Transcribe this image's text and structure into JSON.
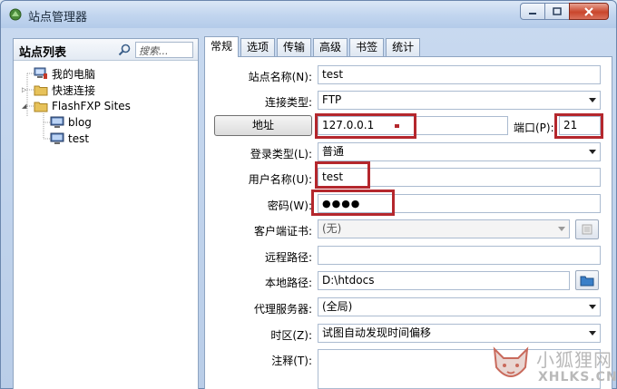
{
  "window": {
    "title": "站点管理器",
    "controls": [
      "minimize",
      "maximize",
      "close"
    ]
  },
  "left_panel": {
    "title": "站点列表",
    "search_placeholder": "搜索...",
    "tree": [
      {
        "label": "我的电脑",
        "icon": "computer-icon"
      },
      {
        "label": "快速连接",
        "icon": "folder-icon"
      },
      {
        "label": "FlashFXP Sites",
        "icon": "folder-icon"
      },
      {
        "label": "blog",
        "icon": "monitor-icon"
      },
      {
        "label": "test",
        "icon": "monitor-icon"
      }
    ]
  },
  "tabs": [
    "常规",
    "选项",
    "传输",
    "高级",
    "书签",
    "统计"
  ],
  "active_tab": "常规",
  "form": {
    "site_name_label": "站点名称(N):",
    "site_name_value": "test",
    "conn_type_label": "连接类型:",
    "conn_type_value": "FTP",
    "address_button": "地址",
    "address_value": "127.0.0.1",
    "port_label": "端口(P):",
    "port_value": "21",
    "login_type_label": "登录类型(L):",
    "login_type_value": "普通",
    "username_label": "用户名称(U):",
    "username_value": "test",
    "password_label": "密码(W):",
    "password_value": "●●●●",
    "cert_label": "客户端证书:",
    "cert_value": "(无)",
    "remote_path_label": "远程路径:",
    "remote_path_value": "",
    "local_path_label": "本地路径:",
    "local_path_value": "D:\\htdocs",
    "proxy_label": "代理服务器:",
    "proxy_value": "(全局)",
    "timezone_label": "时区(Z):",
    "timezone_value": "试图自动发现时间偏移",
    "notes_label": "注释(T):",
    "notes_value": ""
  },
  "colors": {
    "highlight_box": "#b4272d",
    "window_frame": "#b9cde8"
  },
  "watermark": {
    "text_cn": "小狐狸网",
    "text_en": "XHLKS.CN"
  }
}
